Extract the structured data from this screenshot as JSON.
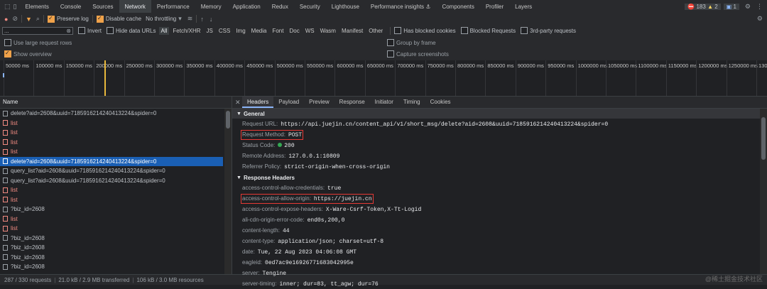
{
  "tabs": [
    "Elements",
    "Console",
    "Sources",
    "Network",
    "Performance",
    "Memory",
    "Application",
    "Redux",
    "Security",
    "Lighthouse",
    "Performance insights ⚓",
    "Components",
    "Profiler",
    "Layers"
  ],
  "active_tab": "Network",
  "badges": {
    "errors": "183",
    "warnings": "2",
    "info": "1"
  },
  "toolbar": {
    "preserve_log": "Preserve log",
    "disable_cache": "Disable cache",
    "throttling": "No throttling"
  },
  "filter": {
    "input_value": "...",
    "invert": "Invert",
    "hide_data_urls": "Hide data URLs",
    "types": [
      "All",
      "Fetch/XHR",
      "JS",
      "CSS",
      "Img",
      "Media",
      "Font",
      "Doc",
      "WS",
      "Wasm",
      "Manifest",
      "Other"
    ],
    "has_blocked_cookies": "Has blocked cookies",
    "blocked_requests": "Blocked Requests",
    "third_party": "3rd-party requests"
  },
  "settings": {
    "large_rows": "Use large request rows",
    "show_overview": "Show overview",
    "group_by_frame": "Group by frame",
    "capture_screenshots": "Capture screenshots"
  },
  "timeline_labels": [
    "50000 ms",
    "100000 ms",
    "150000 ms",
    "200000 ms",
    "250000 ms",
    "300000 ms",
    "350000 ms",
    "400000 ms",
    "450000 ms",
    "500000 ms",
    "550000 ms",
    "600000 ms",
    "650000 ms",
    "700000 ms",
    "750000 ms",
    "800000 ms",
    "850000 ms",
    "900000 ms",
    "950000 ms",
    "1000000 ms",
    "1050000 ms",
    "1100000 ms",
    "1150000 ms",
    "1200000 ms",
    "1250000 ms",
    "1300"
  ],
  "name_header": "Name",
  "requests": [
    {
      "name": "delete?aid=2608&uuid=7185916214240413224&spider=0",
      "type": "normal"
    },
    {
      "name": "list",
      "type": "error"
    },
    {
      "name": "list",
      "type": "error"
    },
    {
      "name": "list",
      "type": "error"
    },
    {
      "name": "list",
      "type": "error"
    },
    {
      "name": "delete?aid=2608&uuid=7185916214240413224&spider=0",
      "type": "selected"
    },
    {
      "name": "query_list?aid=2608&uuid=7185916214240413224&spider=0",
      "type": "normal"
    },
    {
      "name": "query_list?aid=2608&uuid=7185916214240413224&spider=0",
      "type": "normal"
    },
    {
      "name": "list",
      "type": "error"
    },
    {
      "name": "list",
      "type": "error"
    },
    {
      "name": "?biz_id=2608",
      "type": "normal"
    },
    {
      "name": "list",
      "type": "error"
    },
    {
      "name": "list",
      "type": "error"
    },
    {
      "name": "?biz_id=2608",
      "type": "normal"
    },
    {
      "name": "?biz_id=2608",
      "type": "normal"
    },
    {
      "name": "?biz_id=2608",
      "type": "normal"
    },
    {
      "name": "?biz_id=2608",
      "type": "normal"
    }
  ],
  "status": {
    "requests": "287 / 330 requests",
    "transferred": "21.0 kB / 2.9 MB transferred",
    "resources": "106 kB / 3.0 MB resources"
  },
  "detail_tabs": [
    "Headers",
    "Payload",
    "Preview",
    "Response",
    "Initiator",
    "Timing",
    "Cookies"
  ],
  "general": {
    "title": "General",
    "rows": [
      {
        "k": "Request URL:",
        "v": "https://api.juejin.cn/content_api/v1/short_msg/delete?aid=2608&uuid=7185916214240413224&spider=0",
        "hl": false
      },
      {
        "k": "Request Method:",
        "v": "POST",
        "hl": true
      },
      {
        "k": "Status Code:",
        "v": "200",
        "hl": false,
        "dot": true
      },
      {
        "k": "Remote Address:",
        "v": "127.0.0.1:10809",
        "hl": false
      },
      {
        "k": "Referrer Policy:",
        "v": "strict-origin-when-cross-origin",
        "hl": false
      }
    ]
  },
  "response_headers": {
    "title": "Response Headers",
    "rows": [
      {
        "k": "access-control-allow-credentials:",
        "v": "true",
        "hl": false
      },
      {
        "k": "access-control-allow-origin:",
        "v": "https://juejin.cn",
        "hl": true
      },
      {
        "k": "access-control-expose-headers:",
        "v": "X-Ware-Csrf-Token,X-Tt-Logid",
        "hl": false
      },
      {
        "k": "ali-cdn-origin-error-code:",
        "v": "end0s,200,0",
        "hl": false
      },
      {
        "k": "content-length:",
        "v": "44",
        "hl": false
      },
      {
        "k": "content-type:",
        "v": "application/json; charset=utf-8",
        "hl": false
      },
      {
        "k": "date:",
        "v": "Tue, 22 Aug 2023 04:06:08 GMT",
        "hl": false
      },
      {
        "k": "eagleid:",
        "v": "0ed7ac9e16926771683042995e",
        "hl": false
      },
      {
        "k": "server:",
        "v": "Tengine",
        "hl": false
      },
      {
        "k": "server-timing:",
        "v": "inner; dur=83, tt_agw; dur=76",
        "hl": false
      }
    ]
  },
  "watermark": "@稀土掘金技术社区"
}
